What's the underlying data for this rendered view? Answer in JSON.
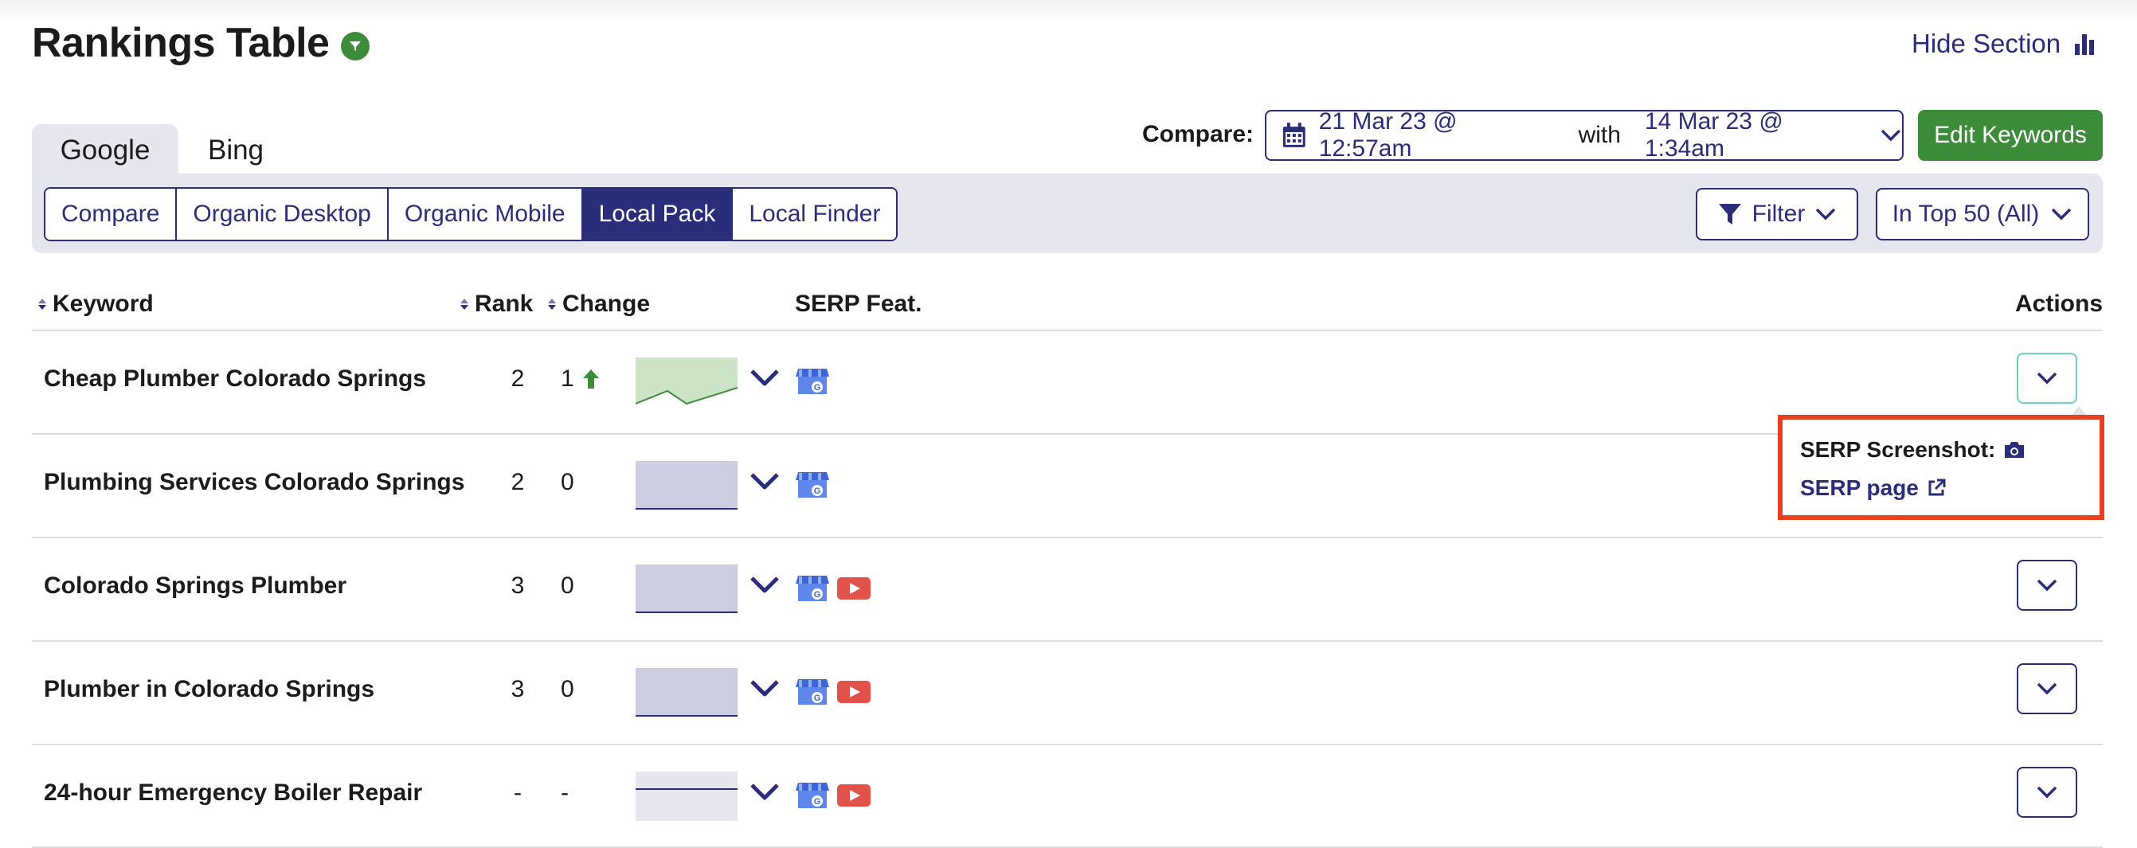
{
  "header": {
    "title": "Rankings Table",
    "hide_section": "Hide Section"
  },
  "engines": [
    "Google",
    "Bing"
  ],
  "views": [
    "Compare",
    "Organic Desktop",
    "Organic Mobile",
    "Local Pack",
    "Local Finder"
  ],
  "active_view": "Local Pack",
  "compare": {
    "label": "Compare:",
    "date_from": "21 Mar 23 @ 12:57am",
    "with": "with",
    "date_to": "14 Mar 23 @ 1:34am"
  },
  "edit_keywords": "Edit Keywords",
  "filter": "Filter",
  "top_filter": "In Top 50 (All)",
  "columns": {
    "keyword": "Keyword",
    "rank": "Rank",
    "change": "Change",
    "serp": "SERP Feat.",
    "actions": "Actions"
  },
  "rows": [
    {
      "keyword": "Cheap Plumber Colorado Springs",
      "rank": "2",
      "change": "1",
      "trend": "up",
      "features": [
        "google-business-icon"
      ]
    },
    {
      "keyword": "Plumbing Services Colorado Springs",
      "rank": "2",
      "change": "0",
      "trend": "flat",
      "features": [
        "google-business-icon"
      ]
    },
    {
      "keyword": "Colorado Springs Plumber",
      "rank": "3",
      "change": "0",
      "trend": "flat",
      "features": [
        "google-business-icon",
        "youtube-icon"
      ]
    },
    {
      "keyword": "Plumber in Colorado Springs",
      "rank": "3",
      "change": "0",
      "trend": "flat",
      "features": [
        "google-business-icon",
        "youtube-icon"
      ]
    },
    {
      "keyword": "24-hour Emergency Boiler Repair",
      "rank": "-",
      "change": "-",
      "trend": "none",
      "features": [
        "google-business-icon",
        "youtube-icon"
      ]
    }
  ],
  "popup": {
    "screenshot_label": "SERP Screenshot:",
    "page_link": "SERP page"
  },
  "colors": {
    "navy": "#2a2d7a",
    "green": "#3d8c3a",
    "panel": "#e6e6ef",
    "highlight": "#e8401f"
  }
}
